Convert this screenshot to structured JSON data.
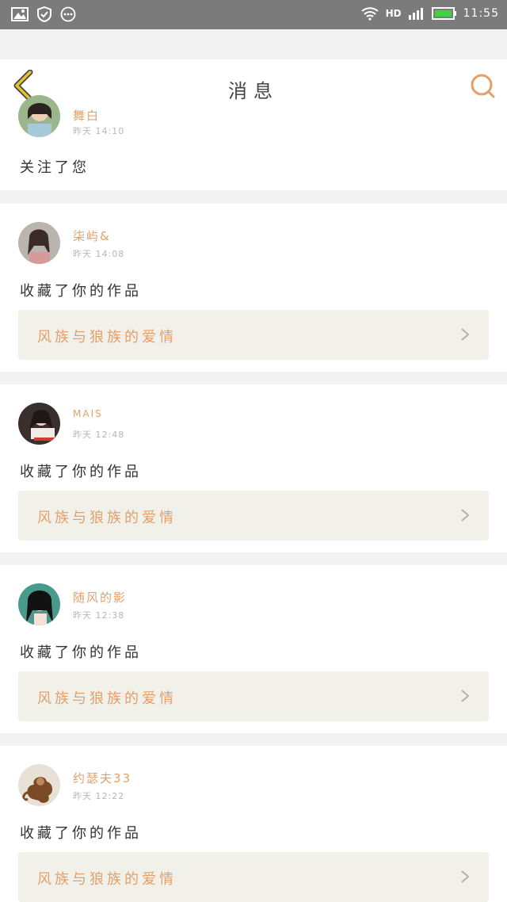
{
  "status_bar": {
    "network": "HD",
    "time": "11:55"
  },
  "header": {
    "title": "消息"
  },
  "notifications": [
    {
      "username": "舞白",
      "time": "昨天 14:10",
      "action": "关注了您",
      "avatar_icon": "avatar-girl-icon"
    },
    {
      "username": "柒屿&",
      "time": "昨天 14:08",
      "action": "收藏了你的作品",
      "work_title": "风族与狼族的爱情",
      "avatar_icon": "avatar-girl-icon"
    },
    {
      "username": "MAIS",
      "time": "昨天 12:48",
      "action": "收藏了你的作品",
      "work_title": "风族与狼族的爱情",
      "avatar_icon": "avatar-girl-icon"
    },
    {
      "username": "随风的影",
      "time": "昨天 12:38",
      "action": "收藏了你的作品",
      "work_title": "风族与狼族的爱情",
      "avatar_icon": "avatar-anime-girl-icon"
    },
    {
      "username": "约瑟夫33",
      "time": "昨天 12:22",
      "action": "收藏了你的作品",
      "work_title": "风族与狼族的爱情",
      "avatar_icon": "avatar-monkey-icon"
    }
  ],
  "colors": {
    "accent": "#e3a06a",
    "back_arrow": "#e6c22c",
    "link_background": "#f1f1ea"
  }
}
